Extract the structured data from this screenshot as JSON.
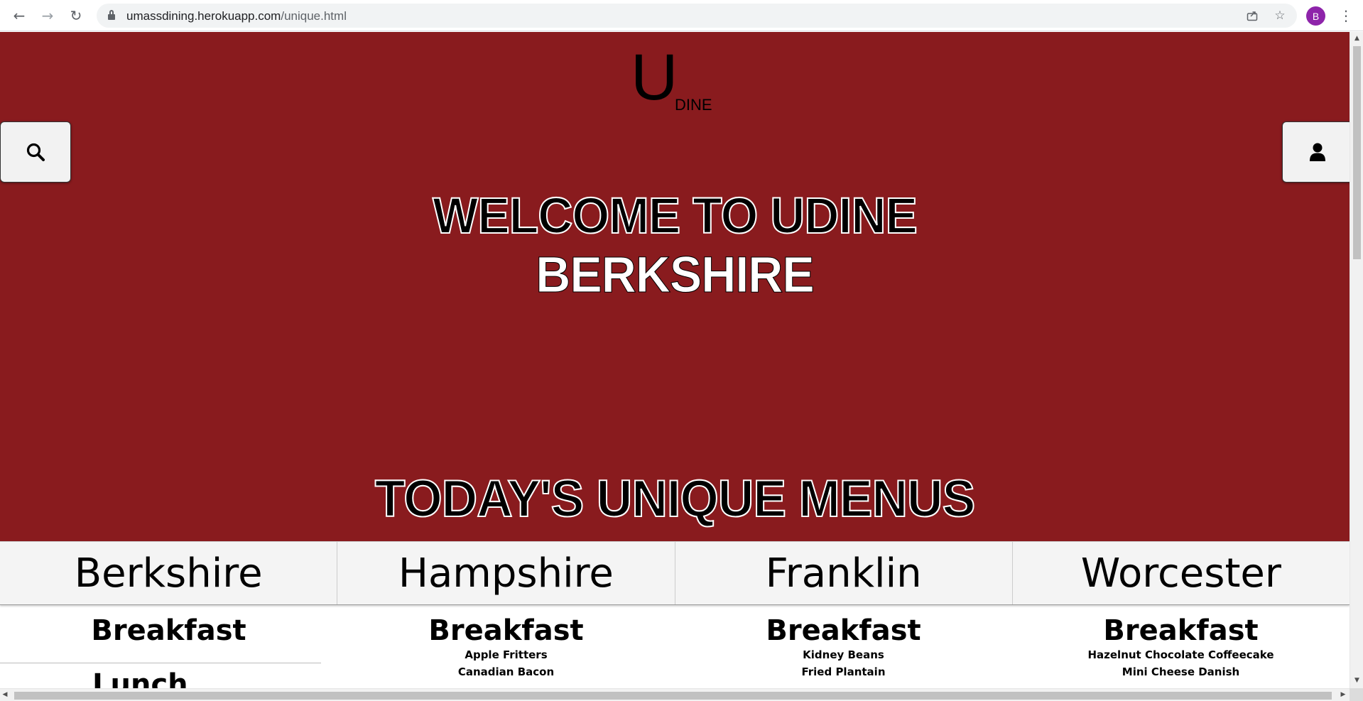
{
  "browser": {
    "url_domain": "umassdining.herokuapp.com",
    "url_path": "/unique.html",
    "profile_initial": "B",
    "icons": [
      "back-arrow-icon",
      "forward-arrow-icon",
      "reload-icon",
      "lock-icon",
      "share-icon",
      "star-icon",
      "kebab-menu-icon"
    ]
  },
  "logo": {
    "big_letter": "U",
    "small_text": "DINE"
  },
  "hero": {
    "welcome": "WELCOME TO UDINE",
    "hall_name": "BERKSHIRE",
    "section_title": "TODAY'S UNIQUE MENUS",
    "background_color": "#891b1e"
  },
  "hall_tabs": [
    "Berkshire",
    "Hampshire",
    "Franklin",
    "Worcester"
  ],
  "menus": [
    {
      "meal": "Breakfast",
      "items": []
    },
    {
      "meal": "Breakfast",
      "items": [
        "Apple Fritters",
        "Canadian Bacon"
      ]
    },
    {
      "meal": "Breakfast",
      "items": [
        "Kidney Beans",
        "Fried Plantain"
      ]
    },
    {
      "meal": "Breakfast",
      "items": [
        "Hazelnut Chocolate Coffeecake",
        "Mini Cheese Danish"
      ]
    }
  ],
  "lunch_peek": "Lunch"
}
